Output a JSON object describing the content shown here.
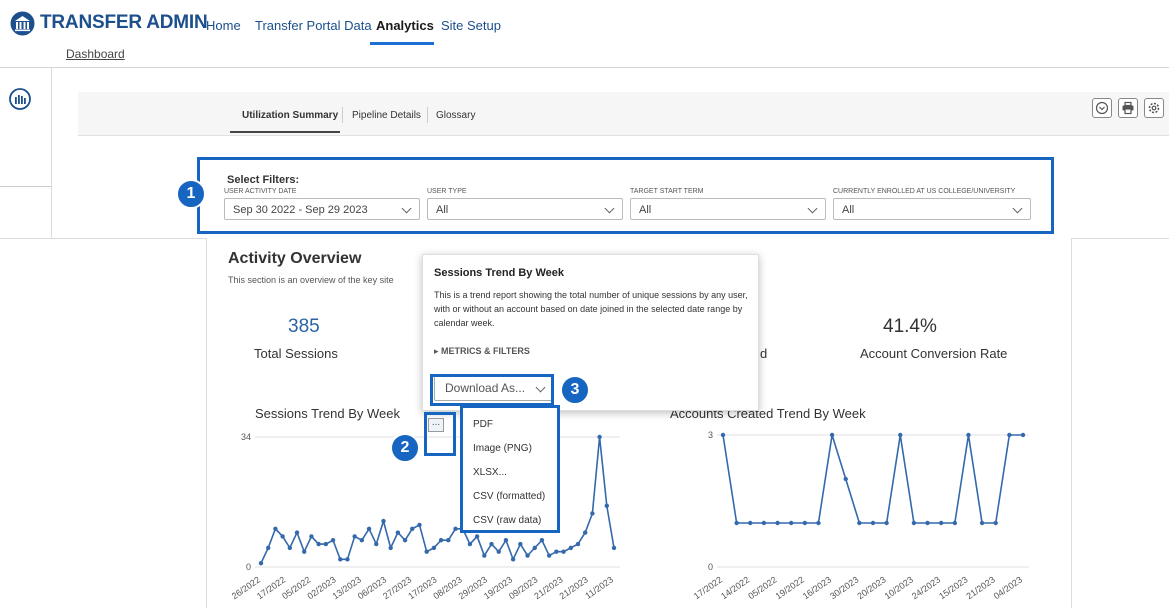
{
  "app": {
    "title": "TRANSFER ADMIN"
  },
  "nav": {
    "items": [
      "Home",
      "Transfer Portal Data",
      "Analytics",
      "Site Setup"
    ],
    "active": "Analytics"
  },
  "breadcrumb": "Dashboard",
  "dash_tabs": [
    "Utilization Summary",
    "Pipeline Details",
    "Glossary"
  ],
  "filters": {
    "title": "Select Filters:",
    "fields": [
      {
        "label": "USER ACTIVITY DATE",
        "value": "Sep 30 2022 - Sep 29 2023"
      },
      {
        "label": "USER TYPE",
        "value": "All"
      },
      {
        "label": "TARGET START TERM",
        "value": "All"
      },
      {
        "label": "CURRENTLY ENROLLED AT US COLLEGE/UNIVERSITY",
        "value": "All"
      }
    ]
  },
  "badges": [
    "1",
    "2",
    "3"
  ],
  "overview": {
    "title": "Activity Overview",
    "desc": "This section is an overview of the key site"
  },
  "kpis": [
    {
      "value": "385",
      "label": "Total Sessions"
    },
    {
      "value": "",
      "label": "d"
    },
    {
      "value": "41.4%",
      "label": "Account Conversion Rate"
    }
  ],
  "popover": {
    "title": "Sessions Trend By Week",
    "desc": "This is a trend report showing the total number of unique sessions by any user, with or without an account based on date joined in the selected date range by calendar week.",
    "metrics": "▸ METRICS & FILTERS",
    "download": "Download As..."
  },
  "download_menu": [
    "PDF",
    "Image (PNG)",
    "XLSX...",
    "CSV (formatted)",
    "CSV (raw data)"
  ],
  "dots_label": "...",
  "chart_data": [
    {
      "type": "line",
      "title": "Sessions Trend By Week",
      "ylim": [
        0,
        34
      ],
      "y_ticks": [
        "0",
        "34"
      ],
      "x_ticks": [
        "26/2022",
        "17/2022",
        "05/2022",
        "02/2023",
        "13/2023",
        "06/2023",
        "27/2023",
        "17/2023",
        "08/2023",
        "29/2023",
        "19/2023",
        "09/2023",
        "21/2023",
        "21/2023",
        "11/2023"
      ],
      "values": [
        1,
        5,
        10,
        8,
        5,
        9,
        4,
        8,
        6,
        6,
        7,
        2,
        2,
        8,
        7,
        10,
        6,
        12,
        5,
        9,
        7,
        10,
        11,
        4,
        5,
        7,
        7,
        10,
        10,
        6,
        8,
        3,
        6,
        4,
        7,
        2,
        6,
        3,
        5,
        7,
        3,
        4,
        4,
        5,
        6,
        9,
        14,
        34,
        16,
        5
      ]
    },
    {
      "type": "line",
      "title": "Accounts Created Trend By Week",
      "ylim": [
        0,
        3
      ],
      "y_ticks": [
        "0",
        "3"
      ],
      "x_ticks": [
        "17/2022",
        "14/2022",
        "05/2022",
        "19/2022",
        "16/2023",
        "30/2023",
        "20/2023",
        "10/2023",
        "24/2023",
        "15/2023",
        "21/2023",
        "04/2023"
      ],
      "values": [
        3,
        1,
        1,
        1,
        1,
        1,
        1,
        1,
        3,
        2,
        1,
        1,
        1,
        3,
        1,
        1,
        1,
        1,
        3,
        1,
        1,
        3,
        3
      ]
    }
  ]
}
